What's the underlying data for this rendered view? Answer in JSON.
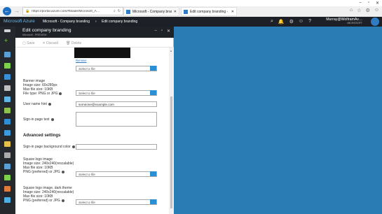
{
  "browser": {
    "url": "https://portal.azure.com/#blade/Microsoft_A…",
    "tabs": [
      {
        "label": "Microsoft - Company branding"
      },
      {
        "label": "Edit company branding - M…"
      }
    ]
  },
  "azure": {
    "brand": "Microsoft Azure",
    "breadcrumb": [
      "Microsoft - Company branding",
      "Edit company branding"
    ],
    "user_name": "Murray@WolframAv…",
    "user_directory": "MICROSOFT"
  },
  "blade": {
    "title": "Edit company branding",
    "subtitle": "Microsoft - PREVIEW",
    "commands": {
      "save": "Save",
      "discard": "Discard",
      "delete": "Delete"
    }
  },
  "form": {
    "remove_link": "Remove",
    "select_file": "Select a file",
    "banner": {
      "line1": "Banner image",
      "line2": "Image size: 60x280px",
      "line3": "Max file size: 10KB",
      "line4": "File type: PNG or JPG"
    },
    "username_label": "User name hint",
    "username_value": "someone@example.com",
    "signin_text_label": "Sign-in page text",
    "advanced_heading": "Advanced settings",
    "bg_color_label": "Sign-in page background color",
    "square_logo": {
      "line1": "Square logo image",
      "line2": "Image size: 240x240(rescalable)",
      "line3": "Max file size: 10KB",
      "line4": "PNG (preferred) or JPG"
    },
    "square_logo_dark": {
      "line1": "Square logo image, dark theme",
      "line2": "Image size: 240x240(rescalable)",
      "line3": "Max file size: 10KB",
      "line4": "PNG (preferred) or JPG"
    }
  },
  "colors": {
    "accent": "#2b8fd6",
    "stage": "#2a7cb5",
    "topbar": "#1d2127"
  }
}
